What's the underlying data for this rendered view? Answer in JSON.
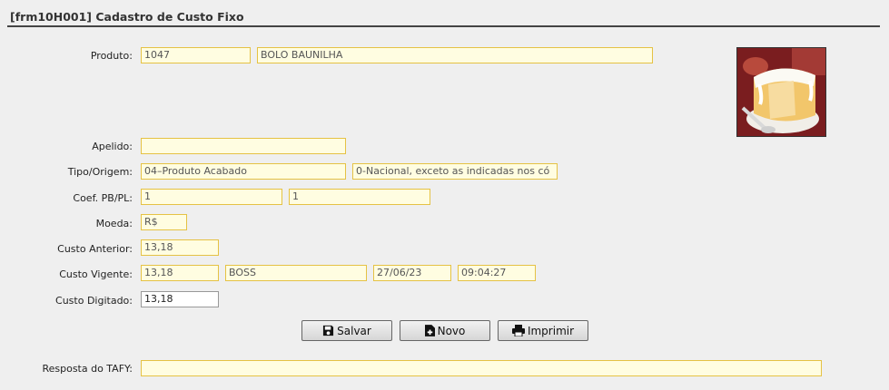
{
  "window": {
    "title": "[frm10H001] Cadastro de Custo Fixo"
  },
  "form": {
    "produto": {
      "label": "Produto:",
      "code": "1047",
      "name": "BOLO BAUNILHA"
    },
    "apelido": {
      "label": "Apelido:",
      "value": ""
    },
    "tipo_origem": {
      "label": "Tipo/Origem:",
      "tipo": "04–Produto Acabado",
      "origem": "0-Nacional, exceto as indicadas nos có"
    },
    "coef": {
      "label": "Coef. PB/PL:",
      "pb": "1",
      "pl": "1"
    },
    "moeda": {
      "label": "Moeda:",
      "value": "R$"
    },
    "custo_anterior": {
      "label": "Custo Anterior:",
      "value": "13,18"
    },
    "custo_vigente": {
      "label": "Custo Vigente:",
      "value": "13,18",
      "user": "BOSS",
      "date": "27/06/23",
      "time": "09:04:27"
    },
    "custo_digitado": {
      "label": "Custo Digitado:",
      "value": "13,18"
    },
    "resposta_tafy": {
      "label": "Resposta do TAFY:",
      "value": ""
    }
  },
  "buttons": {
    "salvar": {
      "label": "Salvar",
      "icon": "save-icon"
    },
    "novo": {
      "label": "Novo",
      "icon": "new-document-icon"
    },
    "imprimir": {
      "label": "Imprimir",
      "icon": "printer-icon"
    }
  },
  "colors": {
    "field_bg": "#fffde1",
    "field_border": "#e5c244",
    "page_bg": "#efefef"
  }
}
